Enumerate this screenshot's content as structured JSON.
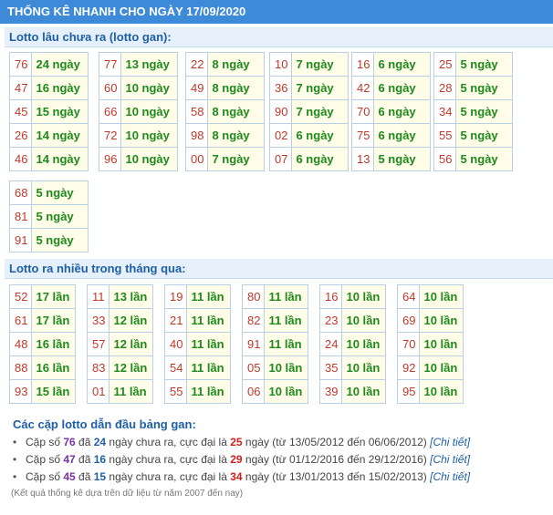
{
  "title": "THỐNG KÊ NHANH CHO NGÀY 17/09/2020",
  "gan": {
    "header": "Lotto lâu chưa ra (lotto gan):",
    "groups": [
      [
        [
          "76",
          "24 ngày"
        ],
        [
          "47",
          "16 ngày"
        ],
        [
          "45",
          "15 ngày"
        ],
        [
          "26",
          "14 ngày"
        ],
        [
          "46",
          "14 ngày"
        ]
      ],
      [
        [
          "77",
          "13 ngày"
        ],
        [
          "60",
          "10 ngày"
        ],
        [
          "66",
          "10 ngày"
        ],
        [
          "72",
          "10 ngày"
        ],
        [
          "96",
          "10 ngày"
        ]
      ],
      [
        [
          "22",
          "8 ngày"
        ],
        [
          "49",
          "8 ngày"
        ],
        [
          "58",
          "8 ngày"
        ],
        [
          "98",
          "8 ngày"
        ],
        [
          "00",
          "7 ngày"
        ]
      ],
      [
        [
          "10",
          "7 ngày"
        ],
        [
          "36",
          "7 ngày"
        ],
        [
          "90",
          "7 ngày"
        ],
        [
          "02",
          "6 ngày"
        ],
        [
          "07",
          "6 ngày"
        ]
      ],
      [
        [
          "16",
          "6 ngày"
        ],
        [
          "42",
          "6 ngày"
        ],
        [
          "70",
          "6 ngày"
        ],
        [
          "75",
          "6 ngày"
        ],
        [
          "13",
          "5 ngày"
        ]
      ],
      [
        [
          "25",
          "5 ngày"
        ],
        [
          "28",
          "5 ngày"
        ],
        [
          "34",
          "5 ngày"
        ],
        [
          "55",
          "5 ngày"
        ],
        [
          "56",
          "5 ngày"
        ]
      ],
      [
        [
          "68",
          "5 ngày"
        ],
        [
          "81",
          "5 ngày"
        ],
        [
          "91",
          "5 ngày"
        ]
      ]
    ]
  },
  "frequent": {
    "header": "Lotto ra nhiều trong tháng qua:",
    "groups": [
      [
        [
          "52",
          "17 lần"
        ],
        [
          "61",
          "17 lần"
        ],
        [
          "48",
          "16 lần"
        ],
        [
          "88",
          "16 lần"
        ],
        [
          "93",
          "15 lần"
        ]
      ],
      [
        [
          "11",
          "13 lần"
        ],
        [
          "33",
          "12 lần"
        ],
        [
          "57",
          "12 lần"
        ],
        [
          "83",
          "12 lần"
        ],
        [
          "01",
          "11 lần"
        ]
      ],
      [
        [
          "19",
          "11 lần"
        ],
        [
          "21",
          "11 lần"
        ],
        [
          "40",
          "11 lần"
        ],
        [
          "54",
          "11 lần"
        ],
        [
          "55",
          "11 lần"
        ]
      ],
      [
        [
          "80",
          "11 lần"
        ],
        [
          "82",
          "11 lần"
        ],
        [
          "91",
          "11 lần"
        ],
        [
          "05",
          "10 lần"
        ],
        [
          "06",
          "10 lần"
        ]
      ],
      [
        [
          "16",
          "10 lần"
        ],
        [
          "23",
          "10 lần"
        ],
        [
          "24",
          "10 lần"
        ],
        [
          "35",
          "10 lần"
        ],
        [
          "39",
          "10 lần"
        ]
      ],
      [
        [
          "64",
          "10 lần"
        ],
        [
          "69",
          "10 lần"
        ],
        [
          "70",
          "10 lần"
        ],
        [
          "92",
          "10 lần"
        ],
        [
          "95",
          "10 lần"
        ]
      ]
    ]
  },
  "pairs": {
    "title": "Các cặp lotto dẫn đầu bảng gan:",
    "items": [
      {
        "prefix": "Cặp số ",
        "num": "76",
        "mid1": " đã ",
        "days": "24",
        "mid2": " ngày chưa ra, cực đại là ",
        "max": "25",
        "suffix": " ngày (từ 13/05/2012 đến 06/06/2012) ",
        "link": "[Chi tiết]"
      },
      {
        "prefix": "Cặp số ",
        "num": "47",
        "mid1": " đã ",
        "days": "16",
        "mid2": " ngày chưa ra, cực đại là ",
        "max": "29",
        "suffix": " ngày (từ 01/12/2016 đến 29/12/2016) ",
        "link": "[Chi tiết]"
      },
      {
        "prefix": "Cặp số ",
        "num": "45",
        "mid1": " đã ",
        "days": "15",
        "mid2": " ngày chưa ra, cực đại là ",
        "max": "34",
        "suffix": " ngày (từ 13/01/2013 đến 15/02/2013) ",
        "link": "[Chi tiết]"
      }
    ]
  },
  "footnote": "(Kết quả thống kê dựa trên dữ liệu từ năm 2007 đến nay)"
}
